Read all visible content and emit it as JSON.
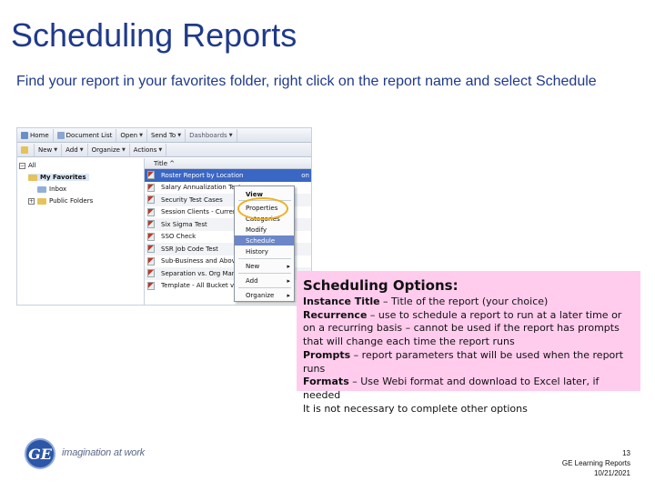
{
  "slide": {
    "title": "Scheduling Reports",
    "subtitle": "Find your report in your favorites folder, right click on the report name and select Schedule"
  },
  "app": {
    "toolbar1": [
      "Home",
      "Document List",
      "Open",
      "Send To",
      "Dashboards"
    ],
    "toolbar2": [
      "New",
      "Add",
      "Organize",
      "Actions"
    ],
    "tree": {
      "all": "All",
      "favorites": "My Favorites",
      "inbox": "Inbox",
      "public": "Public Folders"
    },
    "list_header": "Title ^",
    "reports": [
      "Roster Report by Location",
      "Salary Annualization Test",
      "Security Test Cases",
      "Session Clients - Current W",
      "Six Sigma Test",
      "SSO Check",
      "SSR Job Code Test",
      "Sub-Business and Above Re",
      "Separation vs. Org Manage",
      "Template - All Bucket v2"
    ],
    "row_tail": "on",
    "context_menu": {
      "view": "View",
      "properties": "Properties",
      "categories": "Categories",
      "modify": "Modify",
      "schedule": "Schedule",
      "history": "History",
      "new": "New",
      "add": "Add",
      "organize": "Organize",
      "submenu_arrow": "▸"
    }
  },
  "notes": {
    "title": "Scheduling Options:",
    "items": [
      {
        "label": "Instance Title",
        "text": " – Title of the report (your choice)"
      },
      {
        "label": "Recurrence",
        "text": " – use to schedule a report to run at a later time or on a recurring basis – cannot be used if the report has prompts that will change each time the report runs"
      },
      {
        "label": "Prompts",
        "text": " – report parameters that will be used when the report runs"
      },
      {
        "label": "Formats",
        "text": " – Use Webi format and download to Excel later, if needed"
      }
    ],
    "footer_note": "It is not necessary to complete other options"
  },
  "branding": {
    "logo_text": "GE",
    "tagline": "imagination at work"
  },
  "footer": {
    "page_number": "13",
    "course": "GE Learning Reports",
    "date": "10/21/2021"
  },
  "colors": {
    "title": "#1f3a8a",
    "notes_bg": "#ffccee",
    "highlight_oval": "#f0b020",
    "selected_row": "#3a66c4"
  }
}
